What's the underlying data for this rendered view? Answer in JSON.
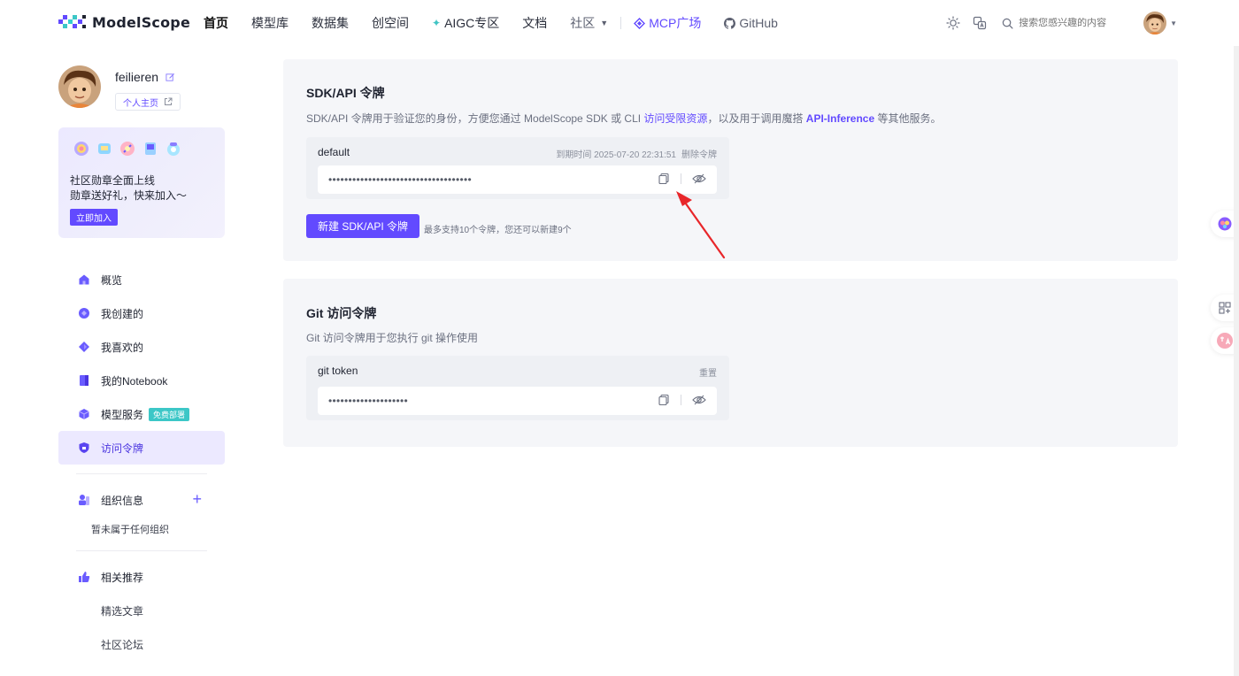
{
  "brand": {
    "name": "ModelScope"
  },
  "nav": {
    "home": "首页",
    "models": "模型库",
    "datasets": "数据集",
    "studios": "创空间",
    "aigc": "AIGC专区",
    "docs": "文档",
    "community": "社区",
    "mcp": "MCP广场",
    "github": "GitHub"
  },
  "search": {
    "placeholder": "搜索您感兴趣的内容"
  },
  "profile": {
    "username": "feilieren",
    "home_label": "个人主页"
  },
  "badge_card": {
    "line1": "社区勋章全面上线",
    "line2": "勋章送好礼，快来加入～",
    "join_label": "立即加入"
  },
  "menu": {
    "overview": "概览",
    "created": "我创建的",
    "liked": "我喜欢的",
    "notebook": "我的Notebook",
    "model_service": "模型服务",
    "free_tag": "免费部署",
    "tokens": "访问令牌"
  },
  "org": {
    "title": "组织信息",
    "empty": "暂未属于任何组织"
  },
  "related": {
    "title": "相关推荐",
    "articles": "精选文章",
    "forum": "社区论坛"
  },
  "sdk_panel": {
    "title": "SDK/API 令牌",
    "desc_prefix": "SDK/API 令牌用于验证您的身份，方便您通过 ModelScope SDK 或 CLI ",
    "desc_link1": "访问受限资源",
    "desc_mid": "，以及用于调用魔搭 ",
    "desc_link2": "API-Inference",
    "desc_suffix": " 等其他服务。",
    "token_name": "default",
    "expire_text": "到期时间 2025-07-20 22:31:51",
    "delete_label": "删除令牌",
    "token_masked": "••••••••••••••••••••••••••••••••••••",
    "new_button": "新建 SDK/API 令牌",
    "hint": "最多支持10个令牌，您还可以新建9个"
  },
  "git_panel": {
    "title": "Git 访问令牌",
    "desc": "Git 访问令牌用于您执行 git 操作使用",
    "token_name": "git token",
    "reset_label": "重置",
    "token_masked": "••••••••••••••••••••"
  },
  "colors": {
    "accent": "#624aff",
    "teal": "#3cc7c7",
    "panel_bg": "#f5f6f9",
    "annotation_red": "#e8262a"
  }
}
